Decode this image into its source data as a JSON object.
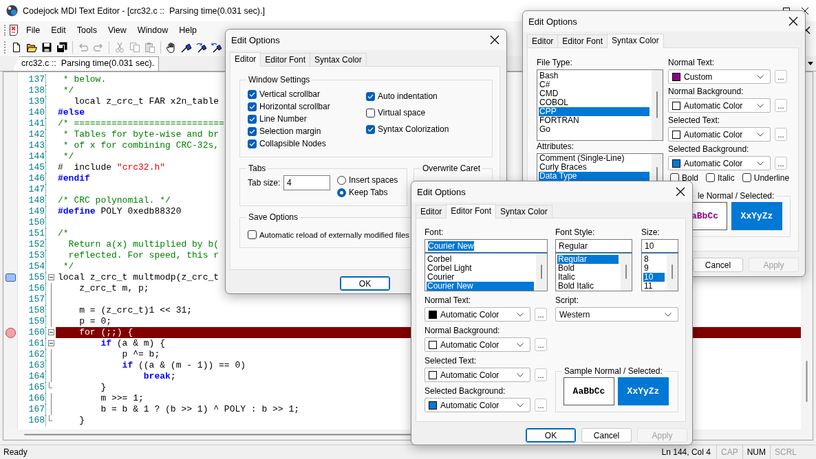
{
  "window": {
    "title": "Codejock MDI Text Editor - [crc32.c ::  Parsing time(0.031 sec).]"
  },
  "menu": [
    "File",
    "Edit",
    "Tools",
    "View",
    "Window",
    "Help"
  ],
  "toolbar": [
    {
      "kind": "new",
      "disabled": false
    },
    {
      "kind": "open",
      "disabled": false
    },
    {
      "kind": "save",
      "disabled": false
    },
    {
      "kind": "save_all",
      "disabled": false
    },
    {
      "kind": "separator"
    },
    {
      "kind": "undo",
      "disabled": true
    },
    {
      "kind": "redo",
      "disabled": true
    },
    {
      "kind": "separator"
    },
    {
      "kind": "cut",
      "disabled": true
    },
    {
      "kind": "copy",
      "disabled": true
    },
    {
      "kind": "paste",
      "disabled": true
    },
    {
      "kind": "separator"
    },
    {
      "kind": "hand",
      "disabled": false
    },
    {
      "kind": "bookmark",
      "disabled": false
    },
    {
      "kind": "bookmark_next",
      "disabled": false
    },
    {
      "kind": "bookmark_prev",
      "disabled": false
    },
    {
      "kind": "separator"
    }
  ],
  "document_tab": "crc32.c ::  Parsing time(0.031 sec).",
  "editor": {
    "lines": [
      {
        "number": "137",
        "highlighted": false,
        "segments": [
          {
            "kind": "comment",
            "text": " * below."
          }
        ]
      },
      {
        "number": "138",
        "highlighted": false,
        "segments": [
          {
            "kind": "comment",
            "text": " */"
          }
        ]
      },
      {
        "number": "139",
        "highlighted": false,
        "segments": [
          {
            "kind": "plain",
            "text": "   local z_crc_t FAR x2n_table"
          }
        ]
      },
      {
        "number": "140",
        "highlighted": false,
        "segments": [
          {
            "kind": "keyword",
            "text": "#else"
          }
        ]
      },
      {
        "number": "141",
        "highlighted": false,
        "segments": [
          {
            "kind": "comment",
            "text": "/* ============================"
          }
        ]
      },
      {
        "number": "142",
        "highlighted": false,
        "segments": [
          {
            "kind": "comment",
            "text": " * Tables for byte-wise and br"
          }
        ]
      },
      {
        "number": "143",
        "highlighted": false,
        "segments": [
          {
            "kind": "comment",
            "text": " * of x for combining CRC-32s,"
          }
        ]
      },
      {
        "number": "144",
        "highlighted": false,
        "segments": [
          {
            "kind": "comment",
            "text": " */"
          }
        ]
      },
      {
        "number": "145",
        "highlighted": false,
        "segments": [
          {
            "kind": "plain",
            "text": "#  include "
          },
          {
            "kind": "string",
            "text": "\"crc32.h\""
          }
        ]
      },
      {
        "number": "146",
        "highlighted": false,
        "segments": [
          {
            "kind": "keyword",
            "text": "#endif"
          }
        ]
      },
      {
        "number": "147",
        "highlighted": false
      },
      {
        "number": "148",
        "highlighted": false,
        "segments": [
          {
            "kind": "comment",
            "text": "/* CRC polynomial. */"
          }
        ]
      },
      {
        "number": "149",
        "highlighted": false,
        "segments": [
          {
            "kind": "keyword",
            "text": "#define"
          },
          {
            "kind": "plain",
            "text": " POLY 0xedb88320"
          }
        ]
      },
      {
        "number": "150",
        "highlighted": false
      },
      {
        "number": "151",
        "highlighted": false,
        "segments": [
          {
            "kind": "comment",
            "text": "/*"
          }
        ]
      },
      {
        "number": "152",
        "highlighted": false,
        "segments": [
          {
            "kind": "comment",
            "text": "  Return a(x) multiplied by b("
          }
        ]
      },
      {
        "number": "153",
        "highlighted": false,
        "segments": [
          {
            "kind": "comment",
            "text": "  reflected. For speed, this r"
          }
        ]
      },
      {
        "number": "154",
        "highlighted": false,
        "segments": [
          {
            "kind": "comment",
            "text": " */"
          }
        ]
      },
      {
        "number": "155",
        "highlighted": false,
        "bookmark": true,
        "fold_start": true,
        "segments": [
          {
            "kind": "plain",
            "text": "local z_crc_t multmodp(z_crc_t"
          }
        ]
      },
      {
        "number": "156",
        "highlighted": false,
        "segments": [
          {
            "kind": "plain",
            "text": "    z_crc_t m, p;"
          }
        ]
      },
      {
        "number": "157",
        "highlighted": false
      },
      {
        "number": "158",
        "highlighted": false,
        "segments": [
          {
            "kind": "plain",
            "text": "    m = (z_crc_t)1 << 31;"
          }
        ]
      },
      {
        "number": "159",
        "highlighted": false,
        "segments": [
          {
            "kind": "plain",
            "text": "    p = 0;"
          }
        ]
      },
      {
        "number": "160",
        "highlighted": true,
        "breakpoint": true,
        "fold_start": true,
        "segments": [
          {
            "kind": "plain",
            "text": "    for (;;) {"
          }
        ]
      },
      {
        "number": "161",
        "highlighted": false,
        "fold_start": true,
        "segments": [
          {
            "kind": "keyword",
            "text": "        if"
          },
          {
            "kind": "plain",
            "text": " (a & m) {"
          }
        ]
      },
      {
        "number": "162",
        "highlighted": false,
        "segments": [
          {
            "kind": "plain",
            "text": "            p ^= b;"
          }
        ]
      },
      {
        "number": "163",
        "highlighted": false,
        "segments": [
          {
            "kind": "keyword",
            "text": "            if"
          },
          {
            "kind": "plain",
            "text": " ((a & (m - 1)) == 0)"
          }
        ]
      },
      {
        "number": "164",
        "highlighted": false,
        "segments": [
          {
            "kind": "keyword",
            "text": "                break"
          },
          {
            "kind": "plain",
            "text": ";"
          }
        ]
      },
      {
        "number": "165",
        "highlighted": false,
        "fold_end": true,
        "segments": [
          {
            "kind": "plain",
            "text": "        }"
          }
        ]
      },
      {
        "number": "166",
        "highlighted": false,
        "segments": [
          {
            "kind": "plain",
            "text": "        m >>= 1;"
          }
        ]
      },
      {
        "number": "167",
        "highlighted": false,
        "segments": [
          {
            "kind": "plain",
            "text": "        b = b & 1 ? (b >> 1) ^ POLY : b >> 1;"
          }
        ]
      },
      {
        "number": "168",
        "highlighted": false,
        "fold_end": true,
        "segments": [
          {
            "kind": "plain",
            "text": "    }"
          }
        ]
      }
    ]
  },
  "status_bar": {
    "message": "Ready",
    "position": "Ln 144, Col 4",
    "indicators": [
      {
        "label": "CAP",
        "on": false
      },
      {
        "label": "NUM",
        "on": true
      },
      {
        "label": "SCRL",
        "on": false
      }
    ]
  },
  "dialogs": [
    {
      "kind": "editor",
      "title": "Edit Options",
      "tabs": [
        {
          "label": "Editor",
          "selected": true
        },
        {
          "label": "Editor Font",
          "selected": false
        },
        {
          "label": "Syntax Color",
          "selected": false
        }
      ],
      "window_settings": {
        "title": "Window Settings",
        "columns": [
          {
            "items": [
              {
                "label": "Vertical scrollbar",
                "checked": true
              },
              {
                "label": "Horizontal scrollbar",
                "checked": true
              },
              {
                "label": "Line Number",
                "checked": true
              },
              {
                "label": "Selection margin",
                "checked": true
              },
              {
                "label": "Collapsible Nodes",
                "checked": true
              }
            ]
          },
          {
            "items": [
              {
                "label": "Auto indentation",
                "checked": true
              },
              {
                "label": "Virtual space",
                "checked": false
              },
              {
                "label": "Syntax Colorization",
                "checked": true
              }
            ]
          }
        ]
      },
      "tabs_group": {
        "title": "Tabs",
        "label": "Tab size:",
        "value": "4",
        "options": [
          {
            "label": "Insert spaces",
            "selected": false
          },
          {
            "label": "Keep Tabs",
            "selected": true
          }
        ]
      },
      "overwrite_caret": {
        "title": "Overwrite Caret"
      },
      "save_options": {
        "title": "Save Options",
        "items": [
          {
            "label": "Automatic reload of externally modified files",
            "checked": false
          }
        ]
      },
      "buttons": [
        {
          "kind": "ok",
          "label": "OK",
          "default": true,
          "disabled": false
        }
      ]
    },
    {
      "kind": "syntax_color",
      "title": "Edit Options",
      "tabs": [
        {
          "label": "Editor",
          "selected": false
        },
        {
          "label": "Editor Font",
          "selected": false
        },
        {
          "label": "Syntax Color",
          "selected": true
        }
      ],
      "file_type": {
        "label": "File Type:",
        "items": [
          {
            "text": "Bash",
            "selected": false
          },
          {
            "text": "C#",
            "selected": false
          },
          {
            "text": "CMD",
            "selected": false
          },
          {
            "text": "COBOL",
            "selected": false
          },
          {
            "text": "CPP",
            "selected": true
          },
          {
            "text": "FORTRAN",
            "selected": false
          },
          {
            "text": "Go",
            "selected": false
          }
        ]
      },
      "attributes": {
        "label": "Attributes:",
        "items": [
          {
            "text": "Comment (Single-Line)",
            "selected": false
          },
          {
            "text": "Curly Braces",
            "selected": false
          },
          {
            "text": "Data Type",
            "selected": true
          }
        ]
      },
      "colors": [
        {
          "label": "Normal Text:",
          "value": "Custom",
          "color": "#8b008b",
          "browse": "..."
        },
        {
          "label": "Normal Background:",
          "value": "Automatic Color",
          "color": "#ffffff",
          "browse": "..."
        },
        {
          "label": "Selected Text:",
          "value": "Automatic Color",
          "color": "#ffffff",
          "browse": "..."
        },
        {
          "label": "Selected Background:",
          "value": "Automatic Color",
          "color": "#0078d4",
          "browse": "..."
        }
      ],
      "styles": [
        {
          "label": "Bold",
          "checked": false
        },
        {
          "label": "Italic",
          "checked": false
        },
        {
          "label": "Underline",
          "checked": false
        }
      ],
      "sample": {
        "title": "le Normal / Selected:",
        "normal": "aBbCc",
        "selected": "XxYyZz"
      },
      "buttons": [
        {
          "kind": "cancel",
          "label": "Cancel",
          "default": false,
          "disabled": false
        },
        {
          "kind": "apply",
          "label": "Apply",
          "default": false,
          "disabled": true
        }
      ]
    },
    {
      "kind": "editor_font",
      "title": "Edit Options",
      "tabs": [
        {
          "label": "Editor",
          "selected": false
        },
        {
          "label": "Editor Font",
          "selected": true
        },
        {
          "label": "Syntax Color",
          "selected": false
        }
      ],
      "font": {
        "label": "Font:",
        "value": "Courier New",
        "value_selected": true,
        "items": [
          {
            "text": "Corbel",
            "selected": false
          },
          {
            "text": "Corbel Light",
            "selected": false
          },
          {
            "text": "Courier",
            "selected": false
          },
          {
            "text": "Courier New",
            "selected": true
          }
        ]
      },
      "font_style": {
        "label": "Font Style:",
        "value": "Regular",
        "items": [
          {
            "text": "Regular",
            "selected": true
          },
          {
            "text": "Bold",
            "selected": false
          },
          {
            "text": "Italic",
            "selected": false
          },
          {
            "text": "Bold Italic",
            "selected": false
          }
        ]
      },
      "size": {
        "label": "Size:",
        "value": "10",
        "items": [
          {
            "text": "8",
            "selected": false
          },
          {
            "text": "9",
            "selected": false
          },
          {
            "text": "10",
            "selected": true
          },
          {
            "text": "11",
            "selected": false
          }
        ]
      },
      "colors": [
        {
          "label": "Normal Text:",
          "value": "Automatic Color",
          "color": "#000000",
          "browse": "..."
        },
        {
          "label": "Normal Background:",
          "value": "Automatic Color",
          "color": "#ffffff",
          "browse": "..."
        },
        {
          "label": "Selected Text:",
          "value": "Automatic Color",
          "color": "#ffffff",
          "browse": "..."
        },
        {
          "label": "Selected Background:",
          "value": "Automatic Color",
          "color": "#0078d4",
          "browse": "..."
        }
      ],
      "script": {
        "label": "Script:",
        "value": "Western"
      },
      "sample": {
        "title": "Sample Normal / Selected:",
        "normal": "AaBbCc",
        "selected": "XxYyZz"
      },
      "buttons": [
        {
          "kind": "ok",
          "label": "OK",
          "default": true,
          "disabled": false
        },
        {
          "kind": "cancel",
          "label": "Cancel",
          "default": false,
          "disabled": false
        },
        {
          "kind": "apply",
          "label": "Apply",
          "default": false,
          "disabled": true
        }
      ]
    }
  ]
}
